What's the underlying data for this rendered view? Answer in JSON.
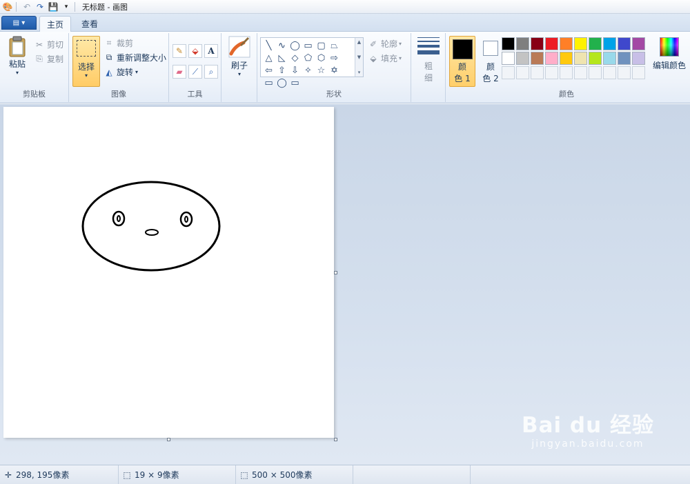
{
  "window": {
    "title": "无标题 - 画图"
  },
  "tabs": {
    "home": "主页",
    "view": "查看"
  },
  "clipboard": {
    "paste": "粘贴",
    "cut": "剪切",
    "copy": "复制",
    "group": "剪贴板"
  },
  "image": {
    "select": "选择",
    "crop": "裁剪",
    "resize": "重新调整大小",
    "rotate": "旋转",
    "group": "图像"
  },
  "tools": {
    "group": "工具"
  },
  "brushes": {
    "label": "刷子"
  },
  "shapes": {
    "group": "形状",
    "outline": "轮廓",
    "fill": "填充",
    "items": [
      "╲",
      "∿",
      "◯",
      "▭",
      "▢",
      "⏢",
      "△",
      "◺",
      "◇",
      "⬠",
      "⬡",
      "⇨",
      "⇦",
      "⇧",
      "⇩",
      "✧",
      "☆",
      "✡",
      "▭",
      "◯",
      "▭"
    ]
  },
  "size": {
    "label1": "粗",
    "label2": "细"
  },
  "colors": {
    "group": "颜色",
    "color1_l1": "颜",
    "color1_l2": "色 1",
    "color2_l1": "颜",
    "color2_l2": "色 2",
    "edit": "编辑颜色",
    "color1": "#000000",
    "color2": "#ffffff",
    "palette_row1": [
      "#000000",
      "#7f7f7f",
      "#880015",
      "#ed1c24",
      "#ff7f27",
      "#fff200",
      "#22b14c",
      "#00a2e8",
      "#3f48cc",
      "#a349a4"
    ],
    "palette_row2": [
      "#ffffff",
      "#c3c3c3",
      "#b97a57",
      "#ffaec9",
      "#ffc90e",
      "#efe4b0",
      "#b5e61d",
      "#99d9ea",
      "#7092be",
      "#c8bfe7"
    ]
  },
  "status": {
    "cursor": "298, 195像素",
    "selection": "19 × 9像素",
    "image_size": "500 × 500像素"
  },
  "watermark": {
    "main": "Bai du 经验",
    "sub": "jingyan.baidu.com"
  }
}
